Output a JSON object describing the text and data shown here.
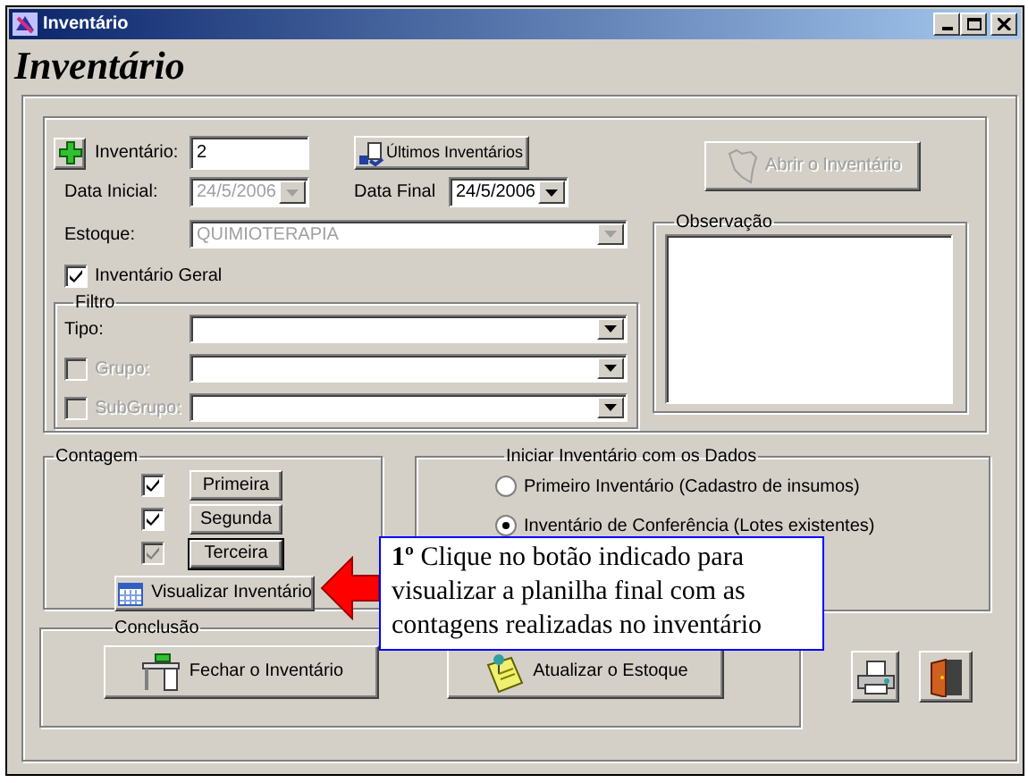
{
  "window": {
    "title": "Inventário"
  },
  "heading": "Inventário",
  "inventario": {
    "label": "Inventário:",
    "value": "2"
  },
  "ultimos_button": "Últimos Inventários",
  "abrir_button": {
    "label": "Abrir o Inventário",
    "disabled": true
  },
  "data_inicial": {
    "label": "Data Inicial:",
    "value": "24/5/2006",
    "disabled": true
  },
  "data_final": {
    "label": "Data Final",
    "value": "24/5/2006",
    "disabled": false
  },
  "estoque": {
    "label": "Estoque:",
    "value": "QUIMIOTERAPIA",
    "disabled": true
  },
  "inventario_geral": {
    "label": "Inventário Geral",
    "checked": true
  },
  "observacao": {
    "label": "Observação"
  },
  "filtro": {
    "label": "Filtro",
    "fields": [
      {
        "label": "Tipo:",
        "kind": "plain",
        "disabled": false
      },
      {
        "label": "Grupo:",
        "kind": "checkbox",
        "checked": false,
        "disabled": true
      },
      {
        "label": "SubGrupo:",
        "kind": "checkbox",
        "checked": false,
        "disabled": true
      }
    ]
  },
  "contagem": {
    "label": "Contagem",
    "rows": [
      {
        "label": "Primeira",
        "checked": true,
        "disabled": false,
        "focused": false
      },
      {
        "label": "Segunda",
        "checked": true,
        "disabled": false,
        "focused": false
      },
      {
        "label": "Terceira",
        "checked": true,
        "disabled": true,
        "focused": true
      }
    ],
    "view_button": "Visualizar Inventário"
  },
  "iniciar": {
    "label": "Iniciar Inventário com os Dados",
    "options": [
      {
        "label": "Primeiro Inventário (Cadastro de insumos)",
        "selected": false
      },
      {
        "label": "Inventário de Conferência (Lotes existentes)",
        "selected": true
      }
    ]
  },
  "conclusao": {
    "label": "Conclusão",
    "buttons": [
      "Fechar o Inventário",
      "Atualizar o Estoque"
    ]
  },
  "callout": {
    "text": "**1º** Clique no botão indicado para visualizar a planilha final com as contagens realizadas no inventário"
  }
}
